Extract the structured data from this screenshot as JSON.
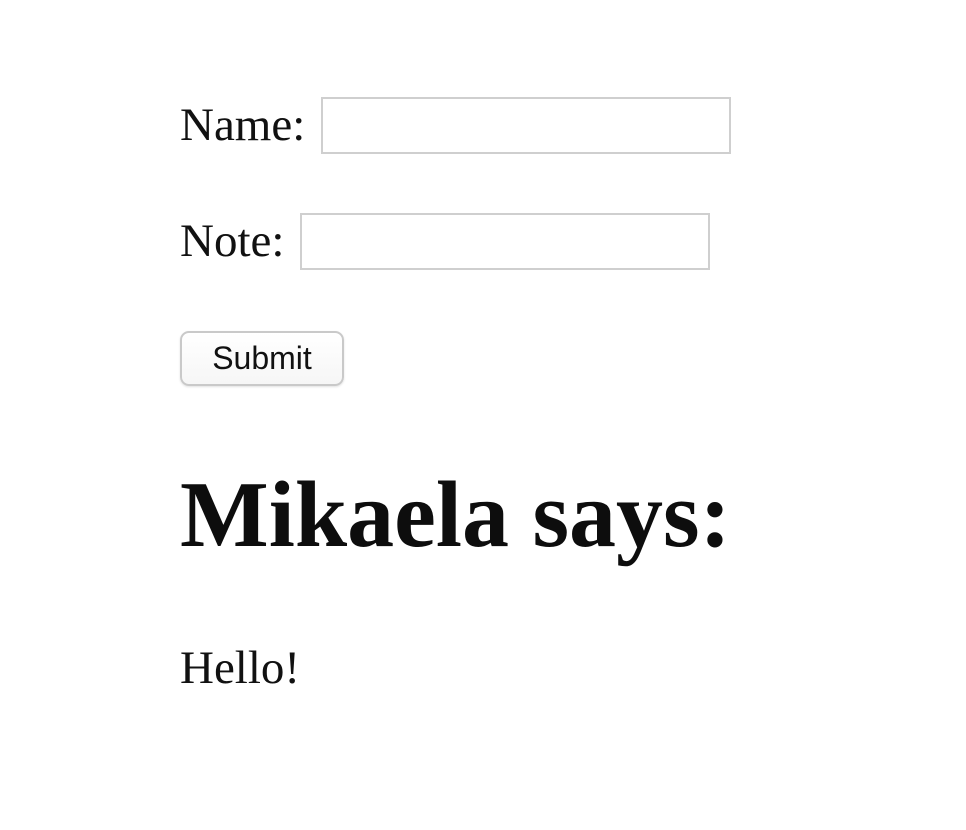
{
  "form": {
    "name_label": "Name:",
    "name_value": "",
    "name_placeholder": "",
    "note_label": "Note:",
    "note_value": "",
    "note_placeholder": "",
    "submit_label": "Submit"
  },
  "output": {
    "heading": "Mikaela says:",
    "message": "Hello!"
  }
}
